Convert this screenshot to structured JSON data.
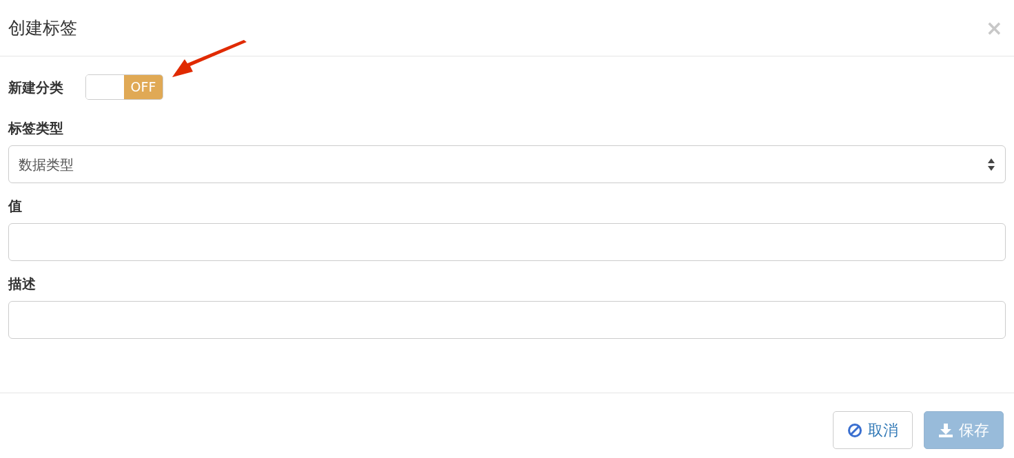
{
  "dialog": {
    "title": "创建标签",
    "close": "×"
  },
  "toggle": {
    "label": "新建分类",
    "on": false,
    "text": "OFF"
  },
  "fields": [
    {
      "kind": "select",
      "label": "标签类型",
      "value": "数据类型"
    },
    {
      "kind": "input",
      "label": "值"
    },
    {
      "kind": "input",
      "label": "描述"
    }
  ],
  "buttons": [
    {
      "kind": "cancel",
      "label": "取消",
      "disabled": false
    },
    {
      "kind": "save",
      "label": "保存",
      "disabled": true
    }
  ]
}
